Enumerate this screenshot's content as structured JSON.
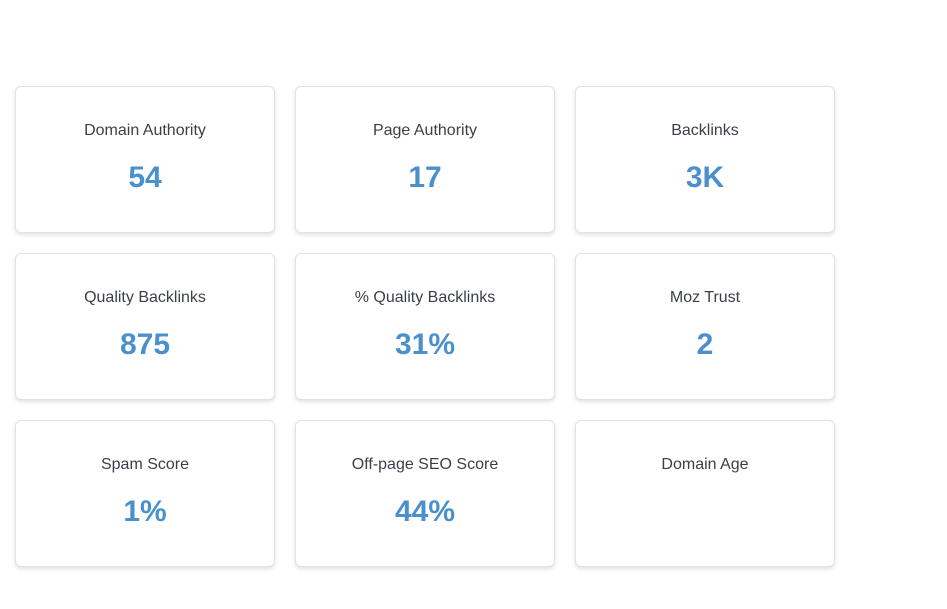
{
  "metrics": [
    {
      "label": "Domain Authority",
      "value": "54"
    },
    {
      "label": "Page Authority",
      "value": "17"
    },
    {
      "label": "Backlinks",
      "value": "3K"
    },
    {
      "label": "Quality Backlinks",
      "value": "875"
    },
    {
      "label": "% Quality Backlinks",
      "value": "31%"
    },
    {
      "label": "Moz Trust",
      "value": "2"
    },
    {
      "label": "Spam Score",
      "value": "1%"
    },
    {
      "label": "Off-page SEO Score",
      "value": "44%"
    },
    {
      "label": "Domain Age",
      "value": ""
    }
  ],
  "colors": {
    "value_accent": "#4a90cf",
    "label_text": "#3a3f4a",
    "card_border": "#e2e2e2"
  }
}
